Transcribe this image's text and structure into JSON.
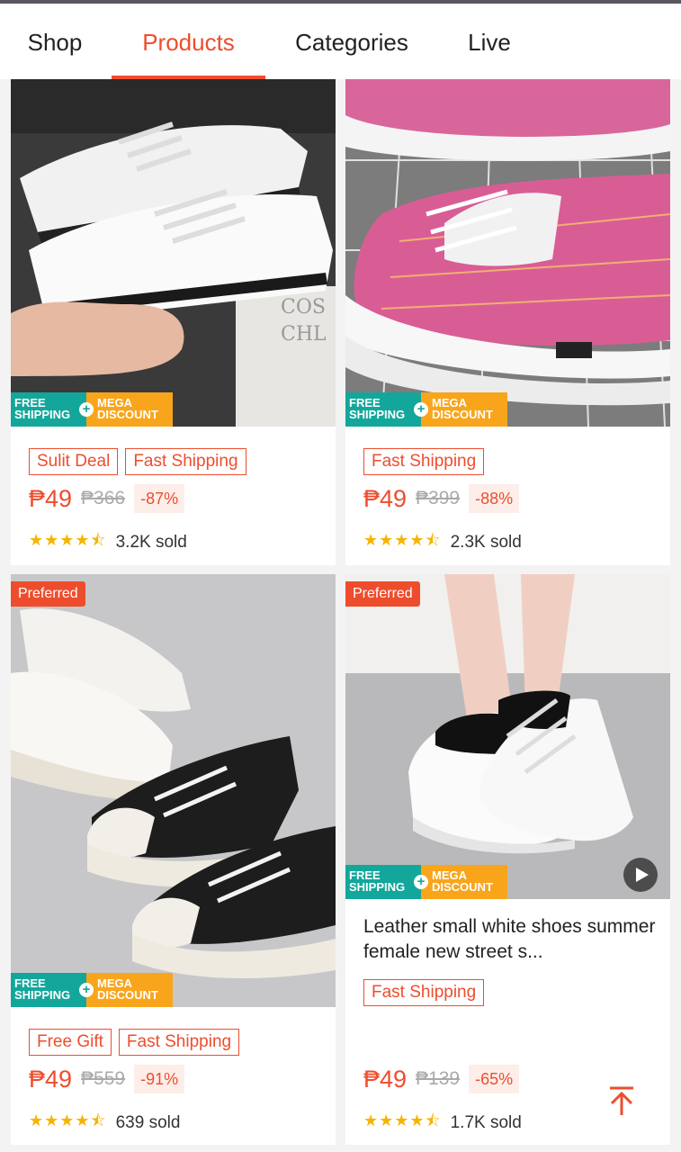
{
  "tabs": [
    {
      "label": "Shop"
    },
    {
      "label": "Products"
    },
    {
      "label": "Categories"
    },
    {
      "label": "Live"
    }
  ],
  "active_tab": "Products",
  "accent_color": "#ee4d2d",
  "badges": {
    "free_line1": "FREE",
    "free_line2": "SHIPPING",
    "mega_line1": "MEGA",
    "mega_line2": "DISCOUNT",
    "preferred": "Preferred"
  },
  "products": [
    {
      "image": "white-canvas-sneakers",
      "tags": [
        "Sulit Deal",
        "Fast Shipping"
      ],
      "price": "₱49",
      "original_price": "₱366",
      "discount": "-87%",
      "rating": 4.5,
      "stars": "★★★★⯪",
      "sold": "3.2K sold"
    },
    {
      "image": "pink-plaid-sneakers",
      "tags": [
        "Fast Shipping"
      ],
      "price": "₱49",
      "original_price": "₱399",
      "discount": "-88%",
      "rating": 4.5,
      "stars": "★★★★⯪",
      "sold": "2.3K sold"
    },
    {
      "image": "white-black-canvas-sneakers",
      "preferred": true,
      "tags": [
        "Free Gift",
        "Fast Shipping"
      ],
      "price": "₱49",
      "original_price": "₱559",
      "discount": "-91%",
      "rating": 4.5,
      "stars": "★★★★⯪",
      "sold": "639 sold"
    },
    {
      "image": "white-chunky-sneakers",
      "preferred": true,
      "has_video": true,
      "title": "Leather small white shoes summer female new street s...",
      "tags": [
        "Fast Shipping"
      ],
      "price": "₱49",
      "original_price": "₱139",
      "discount": "-65%",
      "rating": 4.5,
      "stars": "★★★★⯪",
      "sold": "1.7K sold"
    }
  ],
  "icons": {
    "back_to_top": "arrow-up-to-top-icon",
    "play": "play-icon",
    "star": "star-icon"
  }
}
